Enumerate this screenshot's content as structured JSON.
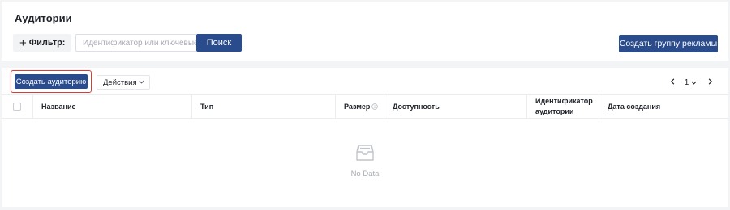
{
  "header": {
    "title": "Аудитории",
    "filter_label": "Фильтр:",
    "search_placeholder": "Идентификатор или ключевые слова",
    "search_button": "Поиск",
    "create_group_button": "Создать группу рекламы"
  },
  "toolbar": {
    "create_audience_button": "Создать аудиторию",
    "actions_label": "Действия",
    "page_number": "1"
  },
  "table": {
    "columns": {
      "name": "Название",
      "type": "Тип",
      "size": "Размер",
      "availability": "Доступность",
      "audience_id_line1": "Идентификатор",
      "audience_id_line2": "аудитории",
      "created": "Дата создания"
    },
    "empty_text": "No Data"
  },
  "colors": {
    "primary": "#2b4c8c",
    "highlight_border": "#e5372f",
    "page_bg": "#f3f4f6"
  },
  "icons": {
    "filter": "plus-icon",
    "actions": "chevron-down-icon",
    "pager_prev": "chevron-left-icon",
    "pager_next": "chevron-right-icon",
    "size_info": "info-icon",
    "empty": "inbox-icon"
  }
}
